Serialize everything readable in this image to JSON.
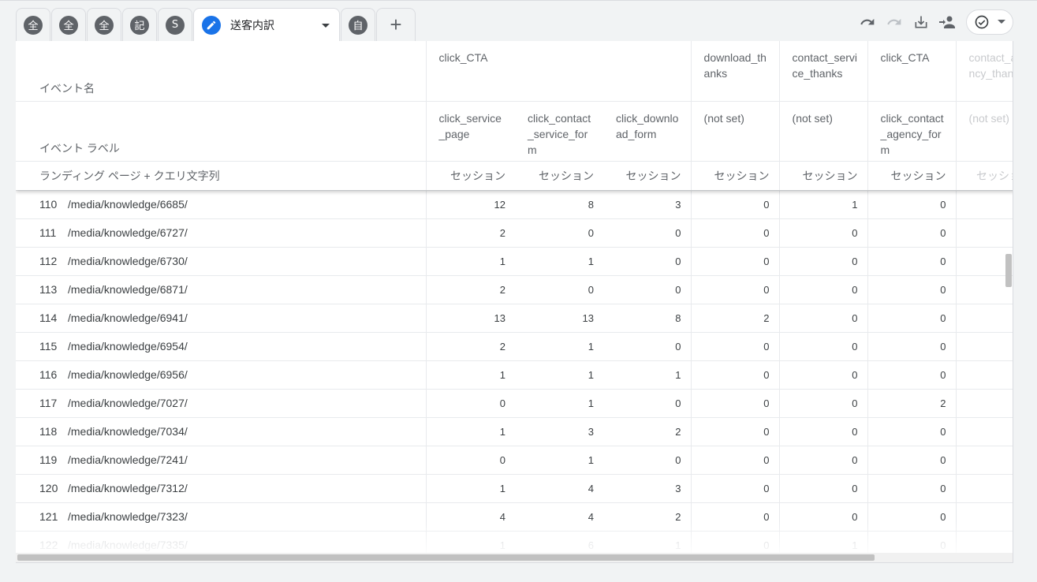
{
  "tabs": {
    "small": [
      {
        "glyph": "全"
      },
      {
        "glyph": "全"
      },
      {
        "glyph": "全"
      },
      {
        "glyph": "記"
      },
      {
        "glyph": "S"
      }
    ],
    "active_title": "送客内訳",
    "after": {
      "glyph": "自"
    },
    "add_glyph": "+"
  },
  "toolbar": {
    "icons": [
      "undo-icon",
      "redo-icon",
      "download-icon",
      "share-icon",
      "check-circle-icon",
      "chevron-down-icon"
    ]
  },
  "table": {
    "dim_headers": {
      "event_name": "イベント名",
      "event_label": "イベント ラベル",
      "landing_page": "ランディング ページ + クエリ文字列"
    },
    "event_groups": [
      {
        "name": "click_CTA",
        "span": 3
      },
      {
        "name": "download_thanks",
        "span": 1
      },
      {
        "name": "contact_service_thanks",
        "span": 1
      },
      {
        "name": "click_CTA",
        "span": 1
      },
      {
        "name": "contact_agency_thanks",
        "span": 1,
        "partial": true
      }
    ],
    "labels": [
      "click_service_page",
      "click_contact_service_form",
      "click_download_form",
      "(not set)",
      "(not set)",
      "click_contact_agency_form",
      "(not set)"
    ],
    "metric": "セッション",
    "rows": [
      {
        "idx": "110",
        "page": "/media/knowledge/6685/",
        "values": [
          "12",
          "8",
          "3",
          "0",
          "1",
          "0"
        ]
      },
      {
        "idx": "111",
        "page": "/media/knowledge/6727/",
        "values": [
          "2",
          "0",
          "0",
          "0",
          "0",
          "0"
        ]
      },
      {
        "idx": "112",
        "page": "/media/knowledge/6730/",
        "values": [
          "1",
          "1",
          "0",
          "0",
          "0",
          "0"
        ]
      },
      {
        "idx": "113",
        "page": "/media/knowledge/6871/",
        "values": [
          "2",
          "0",
          "0",
          "0",
          "0",
          "0"
        ]
      },
      {
        "idx": "114",
        "page": "/media/knowledge/6941/",
        "values": [
          "13",
          "13",
          "8",
          "2",
          "0",
          "0"
        ]
      },
      {
        "idx": "115",
        "page": "/media/knowledge/6954/",
        "values": [
          "2",
          "1",
          "0",
          "0",
          "0",
          "0"
        ]
      },
      {
        "idx": "116",
        "page": "/media/knowledge/6956/",
        "values": [
          "1",
          "1",
          "1",
          "0",
          "0",
          "0"
        ]
      },
      {
        "idx": "117",
        "page": "/media/knowledge/7027/",
        "values": [
          "0",
          "1",
          "0",
          "0",
          "0",
          "2"
        ]
      },
      {
        "idx": "118",
        "page": "/media/knowledge/7034/",
        "values": [
          "1",
          "3",
          "2",
          "0",
          "0",
          "0"
        ]
      },
      {
        "idx": "119",
        "page": "/media/knowledge/7241/",
        "values": [
          "0",
          "1",
          "0",
          "0",
          "0",
          "0"
        ]
      },
      {
        "idx": "120",
        "page": "/media/knowledge/7312/",
        "values": [
          "1",
          "4",
          "3",
          "0",
          "0",
          "0"
        ]
      },
      {
        "idx": "121",
        "page": "/media/knowledge/7323/",
        "values": [
          "4",
          "4",
          "2",
          "0",
          "0",
          "0"
        ]
      },
      {
        "idx": "122",
        "page": "/media/knowledge/7335/",
        "values": [
          "1",
          "6",
          "1",
          "0",
          "1",
          "0"
        ]
      }
    ]
  },
  "colors": {
    "accent": "#1a73e8",
    "icon": "#5f6368"
  }
}
